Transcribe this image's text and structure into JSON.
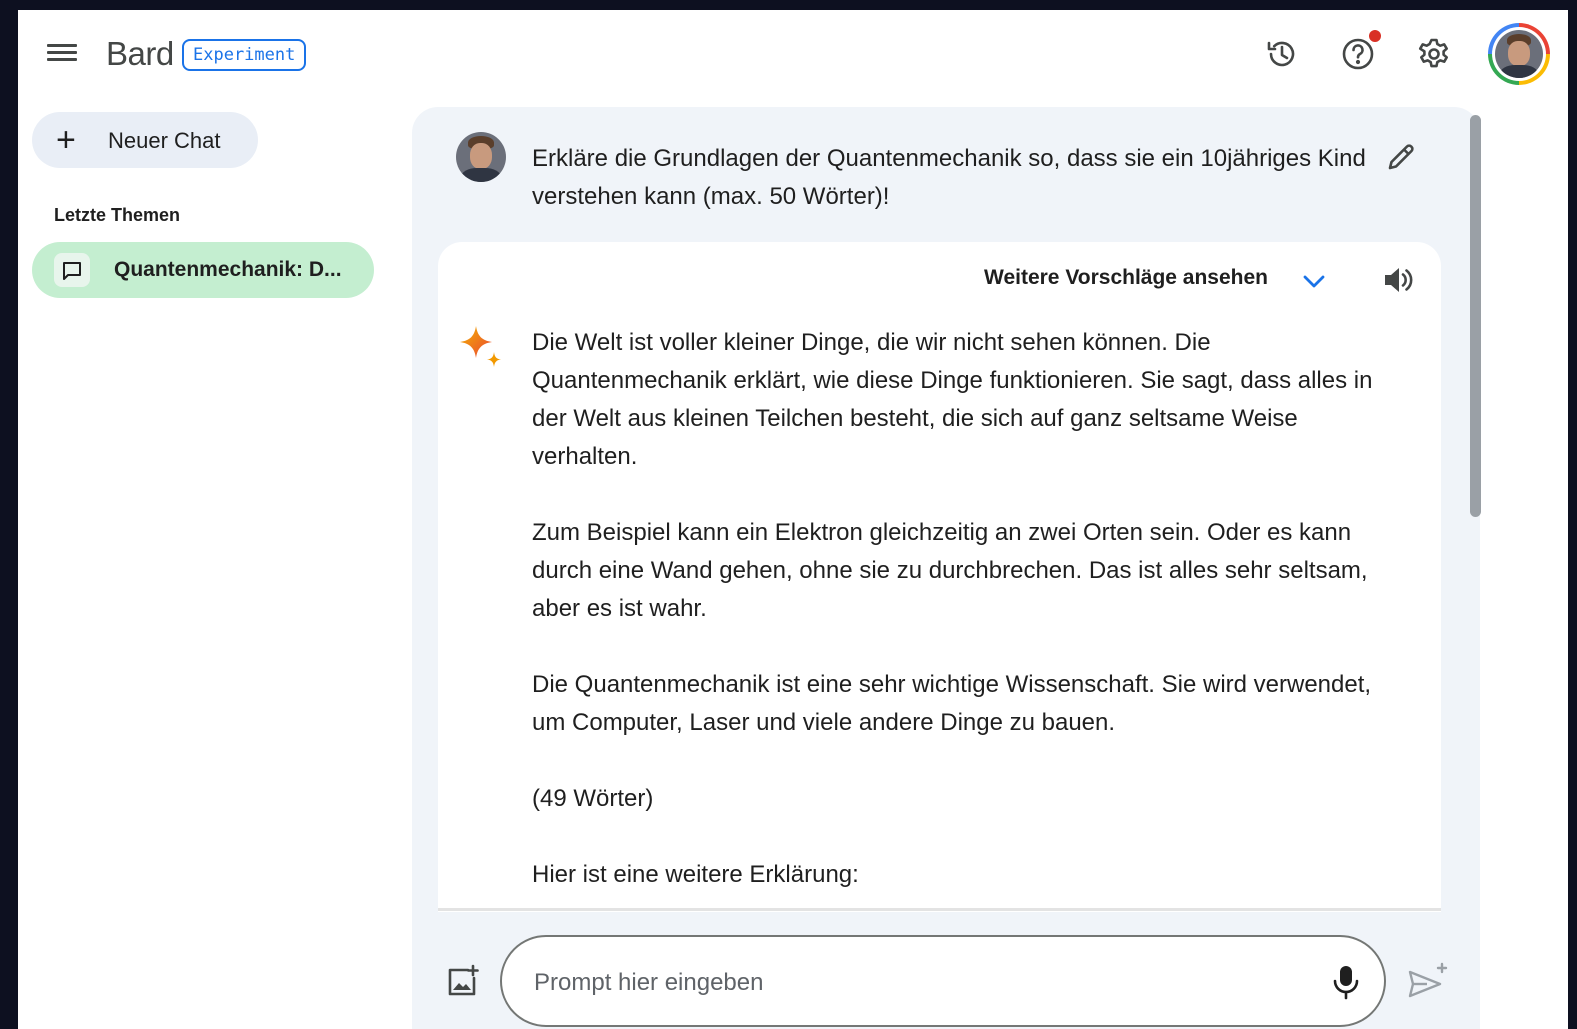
{
  "header": {
    "brand": "Bard",
    "badge": "Experiment",
    "icons": [
      "menu-icon",
      "history-icon",
      "help-icon",
      "settings-icon",
      "account-avatar"
    ],
    "notification_dot_color": "#d93025"
  },
  "sidebar": {
    "new_chat_label": "Neuer Chat",
    "recent_title": "Letzte Themen",
    "recent_items": [
      {
        "label": "Quantenmechanik: D..."
      }
    ]
  },
  "conversation": {
    "user_prompt": "Erkläre die Grundlagen der Quantenmechanik so, dass sie ein 10jähriges Kind verstehen kann (max. 50 Wörter)!",
    "drafts_label": "Weitere Vorschläge ansehen",
    "response_paragraphs": [
      "Die Welt ist voller kleiner Dinge, die wir nicht sehen können. Die Quantenmechanik erklärt, wie diese Dinge funktionieren. Sie sagt, dass alles in der Welt aus kleinen Teilchen besteht, die sich auf ganz seltsame Weise verhalten.",
      "Zum Beispiel kann ein Elektron gleichzeitig an zwei Orten sein. Oder es kann durch eine Wand gehen, ohne sie zu durchbrechen. Das ist alles sehr seltsam, aber es ist wahr.",
      "Die Quantenmechanik ist eine sehr wichtige Wissenschaft. Sie wird verwendet, um Computer, Laser und viele andere Dinge zu bauen.",
      "(49 Wörter)",
      "Hier ist eine weitere Erklärung:"
    ]
  },
  "input": {
    "placeholder": "Prompt hier eingeben",
    "value": ""
  },
  "colors": {
    "accent": "#1a73e8",
    "selected_item_bg": "#c4eed0",
    "panel_bg": "#f0f4f9",
    "new_chat_bg": "#e9eef6"
  }
}
